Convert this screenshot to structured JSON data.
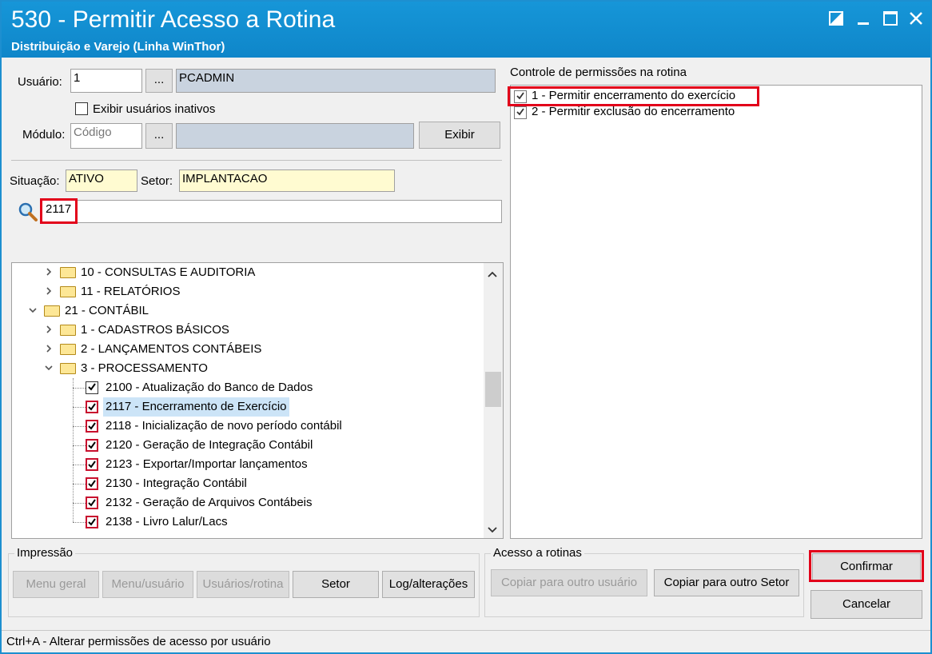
{
  "window": {
    "title": "530 - Permitir Acesso a Rotina",
    "subtitle": "Distribuição e Varejo (Linha WinThor)"
  },
  "form": {
    "usuario_label": "Usuário:",
    "usuario_value": "1",
    "usuario_name": "PCADMIN",
    "browse_label": "...",
    "inativos_label": "Exibir usuários inativos",
    "modulo_label": "Módulo:",
    "modulo_placeholder": "Código",
    "exibir_label": "Exibir",
    "situacao_label": "Situação:",
    "situacao_value": "ATIVO",
    "setor_label": "Setor:",
    "setor_value": "IMPLANTACAO",
    "search_value": "2117"
  },
  "tree": {
    "items": [
      {
        "label": "10 - CONSULTAS E AUDITORIA",
        "level": 1,
        "type": "folder",
        "expanded": false
      },
      {
        "label": "11 - RELATÓRIOS",
        "level": 1,
        "type": "folder",
        "expanded": false
      },
      {
        "label": "21 - CONTÁBIL",
        "level": 0,
        "type": "folder",
        "expanded": true
      },
      {
        "label": "1 - CADASTROS BÁSICOS",
        "level": 1,
        "type": "folder",
        "expanded": false
      },
      {
        "label": "2 - LANÇAMENTOS CONTÁBEIS",
        "level": 1,
        "type": "folder",
        "expanded": false
      },
      {
        "label": "3 - PROCESSAMENTO",
        "level": 1,
        "type": "folder",
        "expanded": true
      },
      {
        "label": "2100 - Atualização do Banco de Dados",
        "level": 2,
        "type": "check",
        "checked": true,
        "red": false
      },
      {
        "label": "2117 - Encerramento de Exercício",
        "level": 2,
        "type": "check",
        "checked": true,
        "red": true,
        "selected": true
      },
      {
        "label": "2118 - Inicialização de novo período contábil",
        "level": 2,
        "type": "check",
        "checked": true,
        "red": true
      },
      {
        "label": "2120 - Geração de Integração Contábil",
        "level": 2,
        "type": "check",
        "checked": true,
        "red": true
      },
      {
        "label": "2123 - Exportar/Importar lançamentos",
        "level": 2,
        "type": "check",
        "checked": true,
        "red": true
      },
      {
        "label": "2130 - Integração Contábil",
        "level": 2,
        "type": "check",
        "checked": true,
        "red": true
      },
      {
        "label": "2132 - Geração de Arquivos Contábeis",
        "level": 2,
        "type": "check",
        "checked": true,
        "red": true
      },
      {
        "label": "2138 - Livro Lalur/Lacs",
        "level": 2,
        "type": "check",
        "checked": true,
        "red": true
      }
    ]
  },
  "permissions": {
    "title": "Controle de permissões na rotina",
    "items": [
      {
        "label": "1 - Permitir encerramento do exercício",
        "checked": true
      },
      {
        "label": "2 - Permitir exclusão do encerramento",
        "checked": true
      }
    ]
  },
  "impressao": {
    "label": "Impressão",
    "menu_geral": "Menu geral",
    "menu_usuario": "Menu/usuário",
    "usuarios_rotina": "Usuários/rotina",
    "setor": "Setor",
    "log": "Log/alterações"
  },
  "acesso": {
    "label": "Acesso a rotinas",
    "copiar_usuario": "Copiar para outro usuário",
    "copiar_setor": "Copiar para outro Setor"
  },
  "actions": {
    "confirmar": "Confirmar",
    "cancelar": "Cancelar"
  },
  "statusbar": {
    "text": "Ctrl+A - Alterar permissões de acesso por usuário"
  },
  "colors": {
    "titlebar": "#1696d8",
    "highlight": "#e2001a"
  }
}
